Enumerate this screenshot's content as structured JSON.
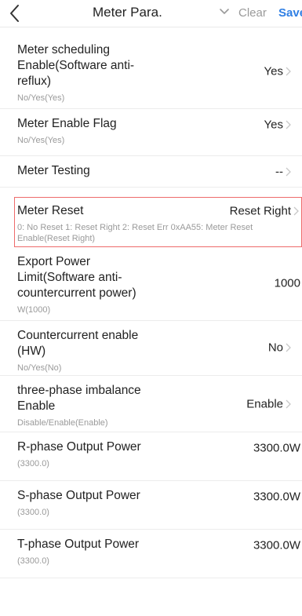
{
  "header": {
    "title": "Meter Para.",
    "clear_label": "Clear",
    "save_label": "Save"
  },
  "items": [
    {
      "label": "Meter scheduling Enable(Software anti-reflux)",
      "value": "Yes",
      "hint": "No/Yes(Yes)",
      "chevron": true
    },
    {
      "label": "Meter Enable Flag",
      "value": "Yes",
      "hint": "No/Yes(Yes)",
      "chevron": true
    },
    {
      "label": "Meter Testing",
      "value": "--",
      "hint": "",
      "chevron": true
    },
    {
      "label": "Meter Reset",
      "value": "Reset Right",
      "hint": "0: No Reset 1: Reset Right 2: Reset Err 0xAA55: Meter Reset Enable(Reset Right)",
      "chevron": true,
      "highlighted": true
    },
    {
      "label": "Export Power Limit(Software anti-countercurrent power)",
      "value": "1000",
      "hint": "W(1000)",
      "chevron": false
    },
    {
      "label": "Countercurrent enable (HW)",
      "value": "No",
      "hint": "No/Yes(No)",
      "chevron": true
    },
    {
      "label": "three-phase imbalance Enable",
      "value": "Enable",
      "hint": "Disable/Enable(Enable)",
      "chevron": true
    },
    {
      "label": "R-phase Output Power",
      "value": "3300.0W",
      "hint": "(3300.0)",
      "chevron": false
    },
    {
      "label": "S-phase Output Power",
      "value": "3300.0W",
      "hint": "(3300.0)",
      "chevron": false
    },
    {
      "label": "T-phase Output Power",
      "value": "3300.0W",
      "hint": "(3300.0)",
      "chevron": false
    }
  ],
  "colors": {
    "accent": "#2f7fe4",
    "highlight_border": "#ee6b6b",
    "hint_text": "#9a9a9a"
  }
}
